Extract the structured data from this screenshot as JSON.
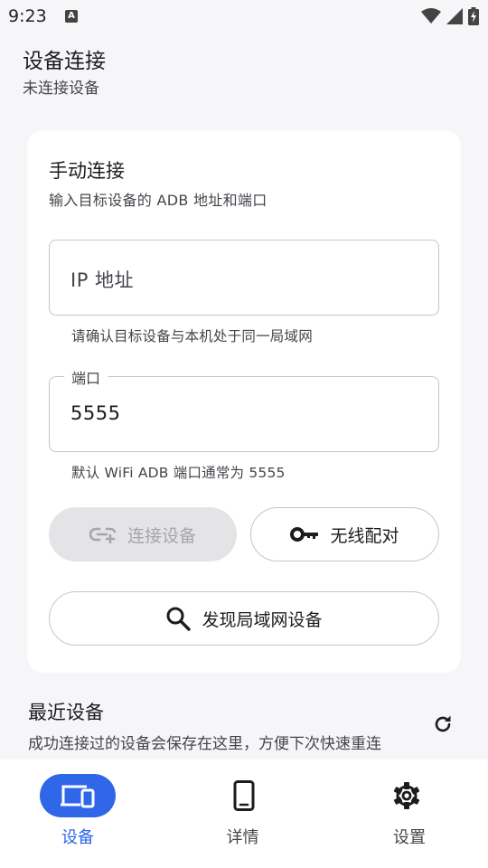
{
  "status_bar": {
    "time": "9:23",
    "notification_letter": "A"
  },
  "header": {
    "title": "设备连接",
    "subtitle": "未连接设备"
  },
  "manual_connect": {
    "title": "手动连接",
    "subtitle": "输入目标设备的 ADB 地址和端口",
    "ip_field": {
      "placeholder": "IP 地址",
      "value": "",
      "helper": "请确认目标设备与本机处于同一局域网"
    },
    "port_field": {
      "label": "端口",
      "value": "5555",
      "helper": "默认 WiFi ADB 端口通常为 5555"
    },
    "connect_button": "连接设备",
    "pair_button": "无线配对",
    "discover_button": "发现局域网设备"
  },
  "recent": {
    "title": "最近设备",
    "subtitle": "成功连接过的设备会保存在这里，方便下次快速重连"
  },
  "bottom_nav": {
    "items": [
      {
        "label": "设备",
        "icon": "devices-icon",
        "active": true
      },
      {
        "label": "详情",
        "icon": "phone-icon",
        "active": false
      },
      {
        "label": "设置",
        "icon": "gear-icon",
        "active": false
      }
    ]
  },
  "colors": {
    "accent": "#2f67e8",
    "background": "#f6f6f8",
    "card": "#ffffff",
    "disabled_bg": "#e4e4e6"
  }
}
